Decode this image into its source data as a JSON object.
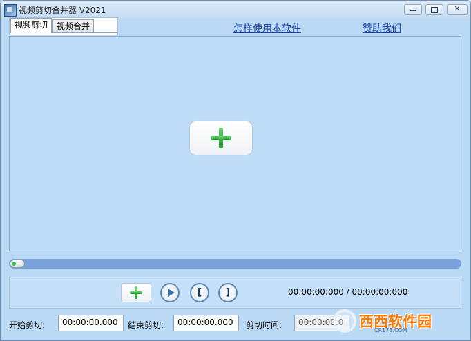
{
  "window": {
    "title": "视频剪切合并器 V2021"
  },
  "tabs": [
    {
      "label": "视频剪切",
      "active": true
    },
    {
      "label": "视频合并",
      "active": false
    }
  ],
  "links": {
    "help": "怎样使用本软件",
    "donate": "赞助我们"
  },
  "player": {
    "add_icon": "plus-icon",
    "progress": 0.0
  },
  "controls": {
    "add_icon": "plus-icon",
    "play_icon": "play-icon",
    "mark_in": "[",
    "mark_out": "]",
    "time_display": "00:00:00:000 / 00:00:00:000"
  },
  "cut": {
    "start_label": "开始剪切:",
    "start_value": "00:00:00.000",
    "end_label": "结束剪切:",
    "end_value": "00:00:00.000",
    "duration_label": "剪切时间:",
    "duration_value": "00:00:00.0"
  },
  "watermark": {
    "text": "西西软件园",
    "sub": "CR173.COM"
  },
  "colors": {
    "accent_green": "#1b9a2a",
    "link": "#1a3fa6",
    "seek": "#7aa2dc"
  }
}
